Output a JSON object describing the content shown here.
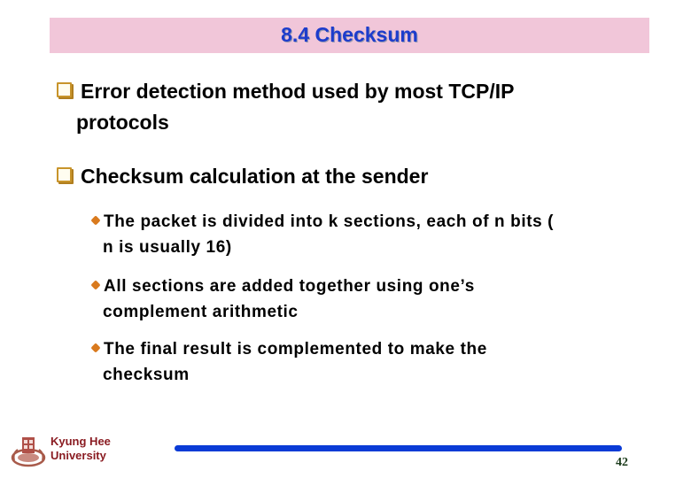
{
  "slide": {
    "title": "8.4 Checksum",
    "bullets": [
      {
        "icon": "square-bullet-icon",
        "line1": "Error detection method used by most TCP/IP",
        "line2": "protocols"
      },
      {
        "icon": "square-bullet-icon",
        "line1": "Checksum calculation at the sender",
        "sub_bullets": [
          {
            "icon": "diamond-bullet-icon",
            "line1": "The packet is divided into k sections, each of n bits (",
            "line2": "n is usually 16)"
          },
          {
            "icon": "diamond-bullet-icon",
            "line1": "All sections are added together using one’s",
            "line2": "complement arithmetic"
          },
          {
            "icon": "diamond-bullet-icon",
            "line1": "The final result is complemented to make the",
            "line2": "checksum"
          }
        ]
      }
    ]
  },
  "footer": {
    "university_line1": "Kyung Hee",
    "university_line2": "University",
    "page_number": "42"
  },
  "colors": {
    "title_bg": "#f1c6d9",
    "title_text": "#1d3ccc",
    "bullet_square": "#c8942b",
    "bullet_diamond": "#d97a1e",
    "university_text": "#8a1c22",
    "footer_rule": "#0a3bd6"
  }
}
